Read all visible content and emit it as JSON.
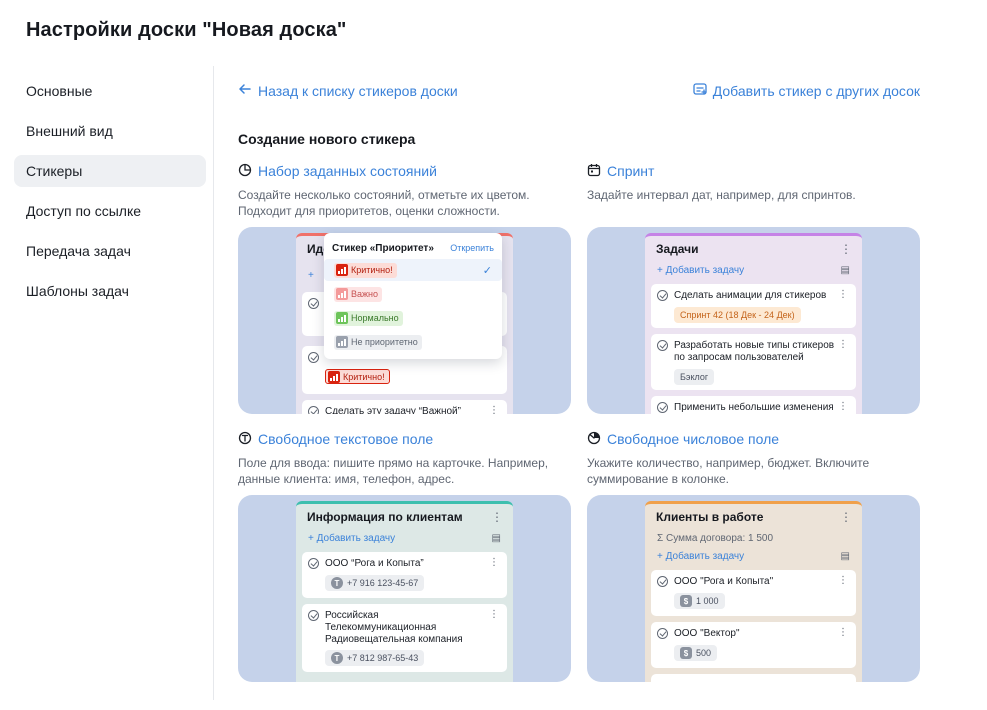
{
  "page": {
    "title": "Настройки доски \"Новая доска\""
  },
  "sidebar": {
    "items": [
      {
        "label": "Основные"
      },
      {
        "label": "Внешний вид"
      },
      {
        "label": "Стикеры",
        "active": true
      },
      {
        "label": "Доступ по ссылке"
      },
      {
        "label": "Передача задач"
      },
      {
        "label": "Шаблоны задач"
      }
    ]
  },
  "top": {
    "back_label": "Назад к списку стикеров доски",
    "add_label": "Добавить стикер с других досок"
  },
  "section_title": "Создание нового стикера",
  "colors": {
    "accent": "#3b82d9",
    "preview_bg": "#c5d2ea",
    "active_nav": "#eef0f3"
  },
  "cards": {
    "states": {
      "icon": "pie-chart-icon",
      "title": "Набор заданных состояний",
      "desc1": "Создайте несколько состояний, отметьте их цветом.",
      "desc2": "Подходит для приоритетов, оценки сложности.",
      "preview": {
        "col_title": "Иде",
        "chip_label": "Критично!",
        "task": "Сделать эту задачу “Важной”",
        "popup": {
          "title": "Стикер «Приоритет»",
          "unpin": "Открепить",
          "options": [
            "Критично!",
            "Важно",
            "Нормально",
            "Не приоритетно"
          ]
        }
      }
    },
    "sprint": {
      "icon": "calendar-icon",
      "title": "Спринт",
      "desc1": "Задайте интервал дат, например, для спринтов.",
      "preview": {
        "col_title": "Задачи",
        "add_task": "Добавить задачу",
        "tasks": [
          {
            "text": "Сделать анимации для стикеров",
            "chip": "Спринт 42 (18 Дек - 24 Дек)"
          },
          {
            "text1": "Разработать новые типы стикеров",
            "text2": "по запросам пользователей",
            "chip": "Бэклог"
          },
          {
            "text": "Применить небольшие изменения"
          }
        ]
      }
    },
    "text": {
      "icon": "text-field-icon",
      "title": "Свободное текстовое поле",
      "desc1": "Поле для ввода: пишите прямо на карточке. Например,",
      "desc2": "данные клиента: имя, телефон, адрес.",
      "preview": {
        "col_title": "Информация по клиентам",
        "add_task": "Добавить задачу",
        "tasks": [
          {
            "text": "ООО “Рога и Копыта”",
            "chip": "+7 916 123-45-67"
          },
          {
            "text1": "Российская",
            "text2": "Телекоммуникационная",
            "text3": "Радиовещательная компания",
            "chip": "+7 812 987-65-43"
          }
        ]
      }
    },
    "number": {
      "icon": "gauge-icon",
      "title": "Свободное числовое поле",
      "desc1": "Укажите количество, например, бюджет. Включите",
      "desc2": "суммирование в колонке.",
      "preview": {
        "col_title": "Клиенты в работе",
        "sum_label": "Сумма договора: 1 500",
        "add_task": "Добавить задачу",
        "tasks": [
          {
            "text": "ООО \"Рога и Копыта\"",
            "chip": "1 000"
          },
          {
            "text": "ООО \"Вектор\"",
            "chip": "500"
          }
        ]
      }
    }
  }
}
